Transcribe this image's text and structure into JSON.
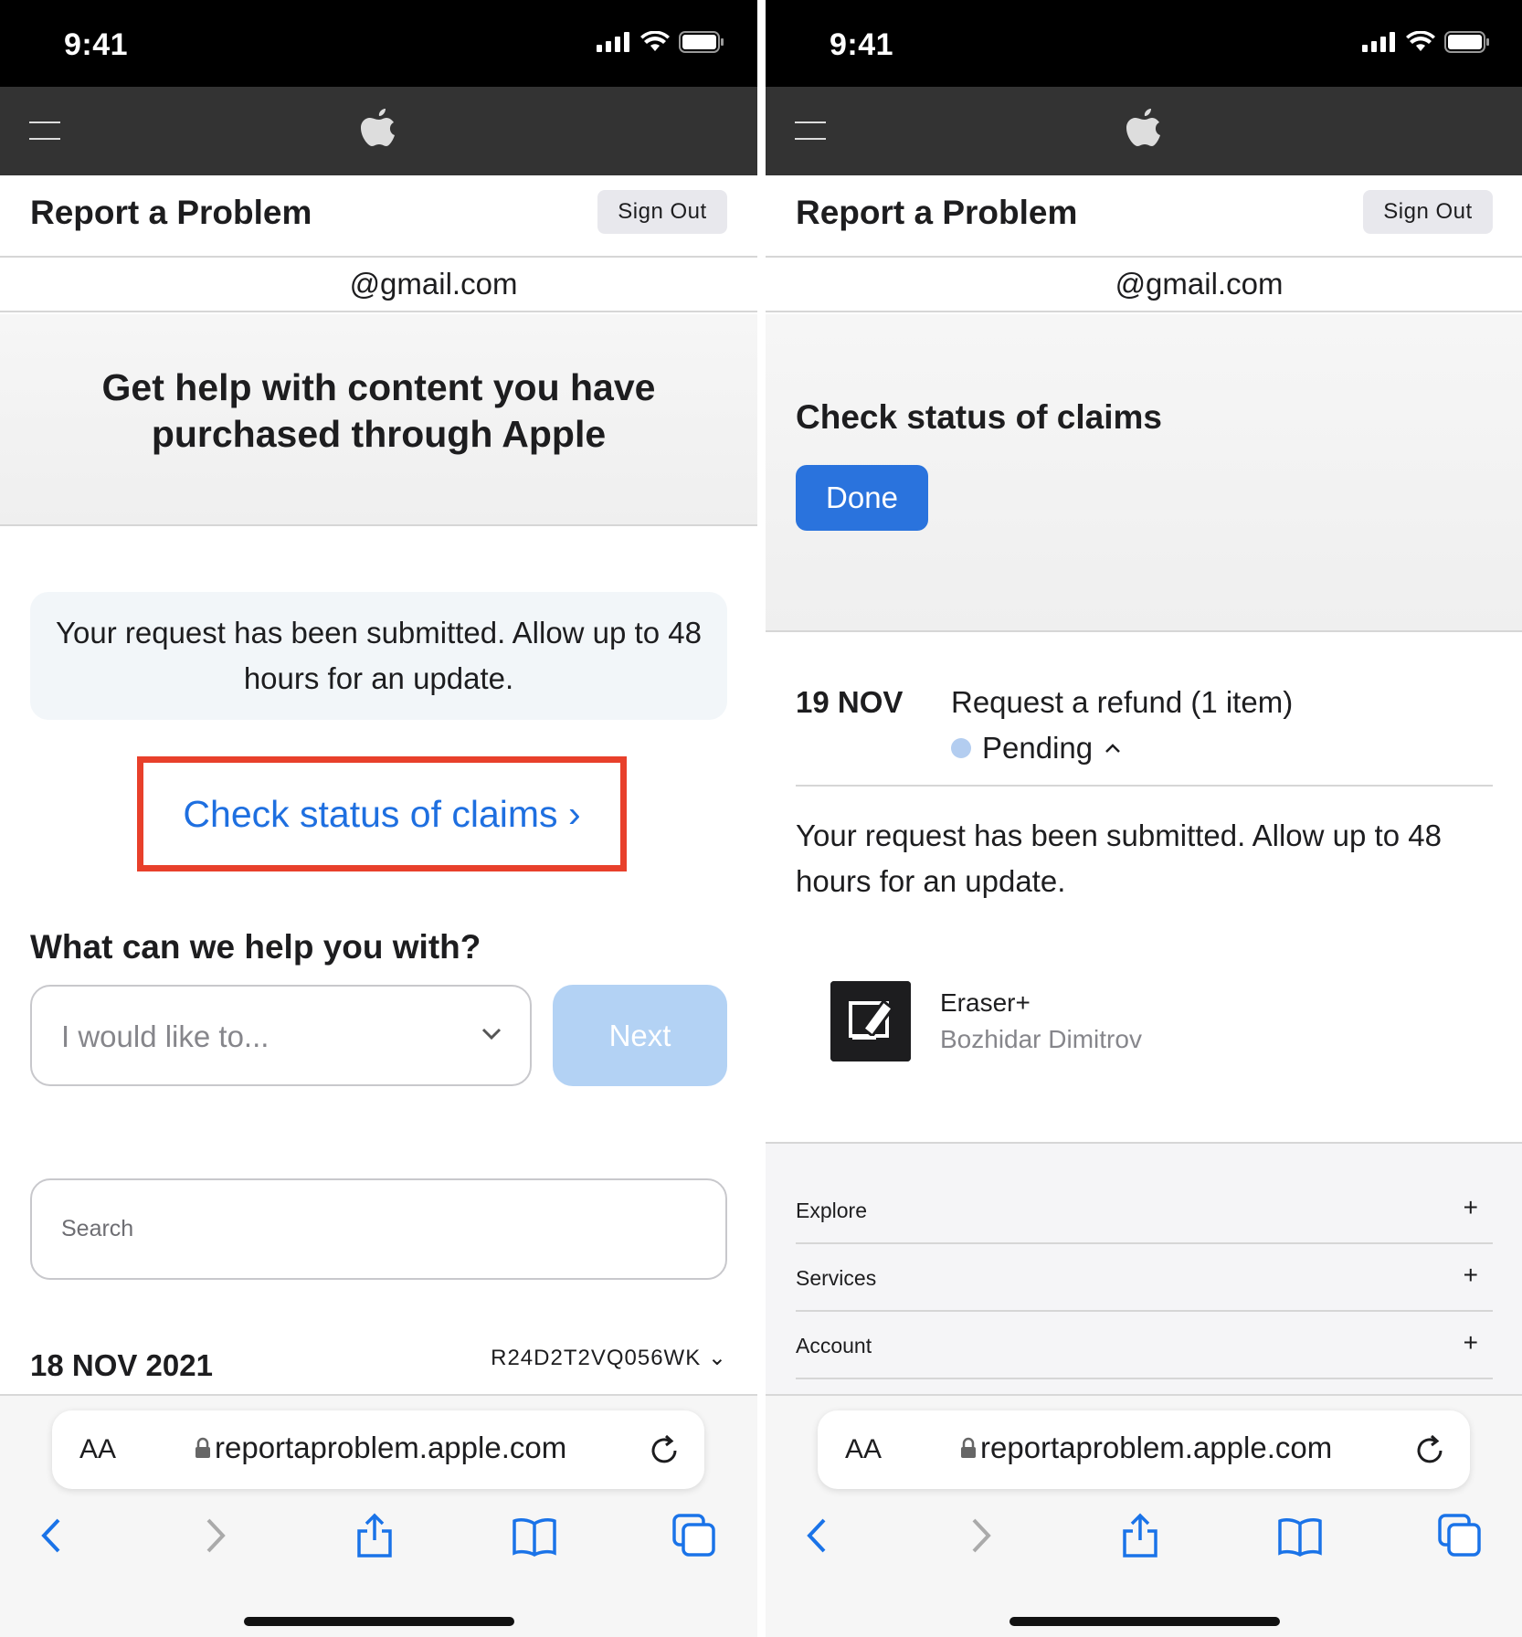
{
  "status_bar": {
    "time": "9:41"
  },
  "header": {
    "title": "Report a Problem",
    "sign_out": "Sign Out",
    "email": "@gmail.com"
  },
  "left": {
    "hero_title": "Get help with content you have purchased through Apple",
    "notice": "Your request has been submitted. Allow up to 48 hours for an update.",
    "check_link": "Check status of claims ›",
    "help_title": "What can we help you with?",
    "select_placeholder": "I would like to...",
    "next_label": "Next",
    "search_placeholder": "Search",
    "order_date": "18 NOV 2021",
    "order_id": "R24D2T2VQ056WK ⌄"
  },
  "right": {
    "hero_title": "Check status of claims",
    "done_label": "Done",
    "claim": {
      "date": "19 NOV",
      "description": "Request a refund (1 item)",
      "status": "Pending",
      "message": "Your request has been submitted. Allow up to 48 hours for an update."
    },
    "app": {
      "name": "Eraser+",
      "developer": "Bozhidar Dimitrov"
    },
    "footer_items": [
      {
        "label": "Explore",
        "toggle": "+"
      },
      {
        "label": "Services",
        "toggle": "+"
      },
      {
        "label": "Account",
        "toggle": "+"
      }
    ]
  },
  "safari": {
    "text_size_label": "AA",
    "url": "reportaproblem.apple.com"
  },
  "colors": {
    "link": "#1e6fe0",
    "highlight_box": "#e8402b",
    "done_button": "#2a73dd",
    "next_disabled": "#b3d2f4",
    "pending_dot": "#b3cdf0"
  },
  "icons": [
    "signal-icon",
    "wifi-icon",
    "battery-icon",
    "menu-icon",
    "apple-logo-icon",
    "chevron-down-icon",
    "lock-icon",
    "reload-icon",
    "back-icon",
    "forward-icon",
    "share-icon",
    "bookmarks-icon",
    "tabs-icon",
    "chevron-up-icon"
  ]
}
